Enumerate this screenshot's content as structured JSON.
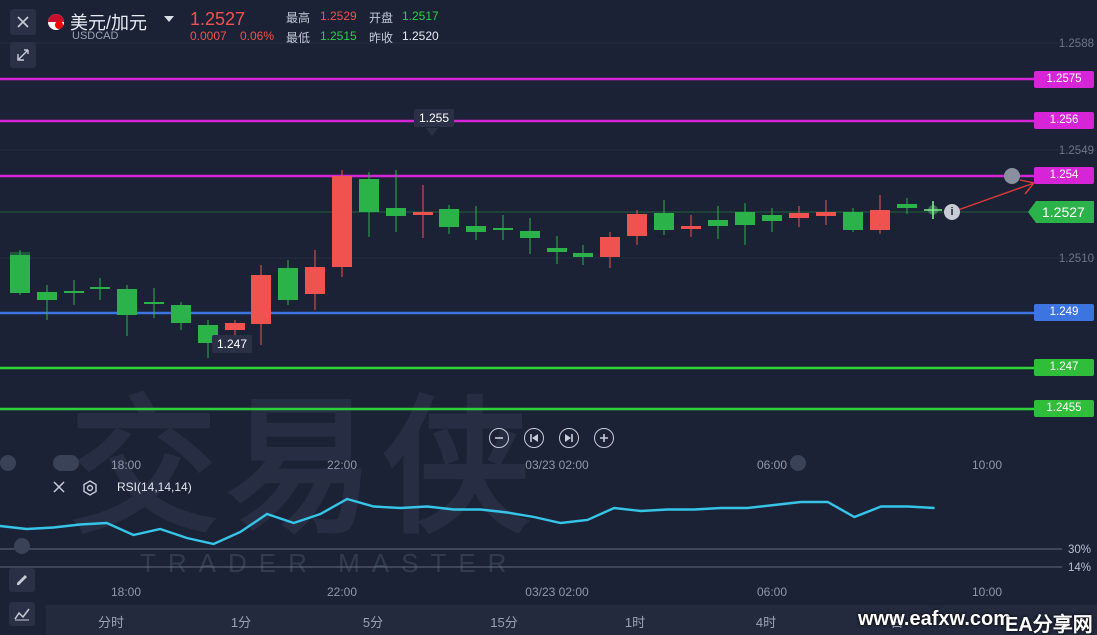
{
  "header": {
    "symbol_name": "美元/加元",
    "symbol_code": "USDCAD",
    "last_price": "1.2527",
    "change": "0.0007",
    "change_pct": "0.06%",
    "high_label": "最高",
    "high_value": "1.2529",
    "open_label": "开盘",
    "open_value": "1.2517",
    "low_label": "最低",
    "low_value": "1.2515",
    "prev_close_label": "昨收",
    "prev_close_value": "1.2520"
  },
  "price_axis": {
    "ticks": [
      "1.2588",
      "1.2549",
      "1.2510"
    ]
  },
  "levels": [
    {
      "label": "1.2575",
      "color": "#d625d6"
    },
    {
      "label": "1.256",
      "color": "#d625d6"
    },
    {
      "label": "1.254",
      "color": "#d625d6"
    },
    {
      "label": "1.249",
      "color": "#3c74e0"
    },
    {
      "label": "1.247",
      "color": "#2fd13a"
    },
    {
      "label": "1.2455",
      "color": "#2fd13a"
    }
  ],
  "current_price_tag": "1.2527",
  "annotations": {
    "high_marker": "1.255",
    "low_marker": "1.247"
  },
  "time_axis": {
    "ticks": [
      "18:00",
      "22:00",
      "03/23 02:00",
      "06:00",
      "10:00"
    ]
  },
  "rsi": {
    "label": "RSI(14,14,14)",
    "levels": [
      "30%",
      "14%"
    ],
    "values": [
      44,
      42,
      43,
      45,
      46,
      38,
      42,
      36,
      32,
      40,
      52,
      46,
      52,
      62,
      57,
      56,
      57,
      55,
      55,
      53,
      50,
      46,
      48,
      56,
      54,
      55,
      55,
      56,
      56,
      58,
      60,
      60,
      50,
      57,
      57,
      56
    ]
  },
  "timeframes": [
    "分时",
    "1分",
    "5分",
    "15分",
    "1时",
    "4时",
    "日"
  ],
  "watermark": {
    "brand_cn": "交易侠",
    "brand_en": "TRADER MASTER",
    "site": "www.eafxw.com",
    "site_cn": "EA分享网"
  },
  "colors": {
    "bull": "#2bb34a",
    "bear": "#f0524f",
    "rsi_line": "#36c5e8",
    "background": "#1b2235"
  }
}
